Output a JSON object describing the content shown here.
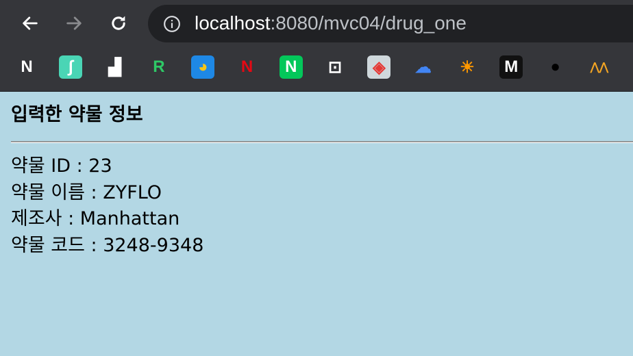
{
  "browser": {
    "url_host": "localhost",
    "url_path": ":8080/mvc04/drug_one",
    "bookmarks": [
      {
        "name": "notability-icon",
        "glyph": "N",
        "color": "#ffffff",
        "bg": "transparent"
      },
      {
        "name": "spline-icon",
        "glyph": "∫",
        "color": "#ffffff",
        "bg": "#4ad5b5"
      },
      {
        "name": "blocks-icon",
        "glyph": "▟",
        "color": "#ffffff",
        "bg": "transparent"
      },
      {
        "name": "replit-icon",
        "glyph": "R",
        "color": "#2ec866",
        "bg": "transparent"
      },
      {
        "name": "bird-icon",
        "glyph": "◕",
        "color": "#f5c518",
        "bg": "#1e88e5"
      },
      {
        "name": "netflix-icon",
        "glyph": "N",
        "color": "#e50914",
        "bg": "transparent"
      },
      {
        "name": "naver-icon",
        "glyph": "N",
        "color": "#ffffff",
        "bg": "#03c75a"
      },
      {
        "name": "chat-bot-icon",
        "glyph": "⊡",
        "color": "#ffffff",
        "bg": "transparent"
      },
      {
        "name": "palette-icon",
        "glyph": "◈",
        "color": "#e53935",
        "bg": "#cfd8dc"
      },
      {
        "name": "cloud-icon",
        "glyph": "☁",
        "color": "#4285f4",
        "bg": "transparent"
      },
      {
        "name": "sunrise-icon",
        "glyph": "☀",
        "color": "#ff9800",
        "bg": "transparent"
      },
      {
        "name": "m-logo-icon",
        "glyph": "M",
        "color": "#ffffff",
        "bg": "#111111"
      },
      {
        "name": "black-circle-icon",
        "glyph": "●",
        "color": "#000000",
        "bg": "transparent"
      },
      {
        "name": "mountain-icon",
        "glyph": "⋀⋀",
        "color": "#f5a623",
        "bg": "transparent"
      }
    ]
  },
  "page": {
    "title": "입력한 약물 정보",
    "fields": [
      "약물 ID : 23",
      "약물 이름 : ZYFLO",
      "제조사 : Manhattan",
      "약물 코드 : 3248-9348"
    ]
  }
}
